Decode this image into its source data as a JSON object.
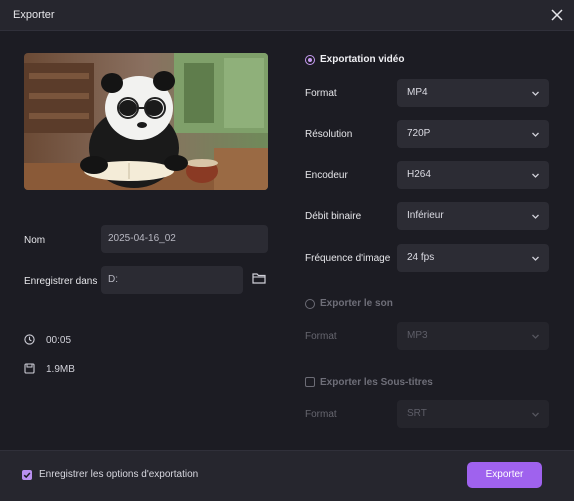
{
  "window": {
    "title": "Exporter"
  },
  "left": {
    "name_label": "Nom",
    "name_value": "2025-04-16_02",
    "save_label": "Enregistrer dans",
    "save_value": "D:",
    "duration": "00:05",
    "size": "1.9MB"
  },
  "video": {
    "section_label": "Exportation vidéo",
    "rows": [
      {
        "label": "Format",
        "value": "MP4"
      },
      {
        "label": "Résolution",
        "value": "720P"
      },
      {
        "label": "Encodeur",
        "value": "H264"
      },
      {
        "label": "Débit binaire",
        "value": "Inférieur"
      },
      {
        "label": "Fréquence d'image",
        "value": "24  fps"
      }
    ]
  },
  "audio": {
    "section_label": "Exporter le son",
    "format_label": "Format",
    "format_value": "MP3"
  },
  "subtitles": {
    "section_label": "Exporter les Sous-titres",
    "format_label": "Format",
    "format_value": "SRT"
  },
  "footer": {
    "remember_label": "Enregistrer les options d'exportation",
    "export_button": "Exporter"
  },
  "colors": {
    "accent": "#9f62ee",
    "background": "#1c1c23"
  },
  "icons": [
    "close-icon",
    "folder-icon",
    "clock-icon",
    "file-size-icon",
    "chevron-down-icon",
    "checkmark-icon"
  ]
}
